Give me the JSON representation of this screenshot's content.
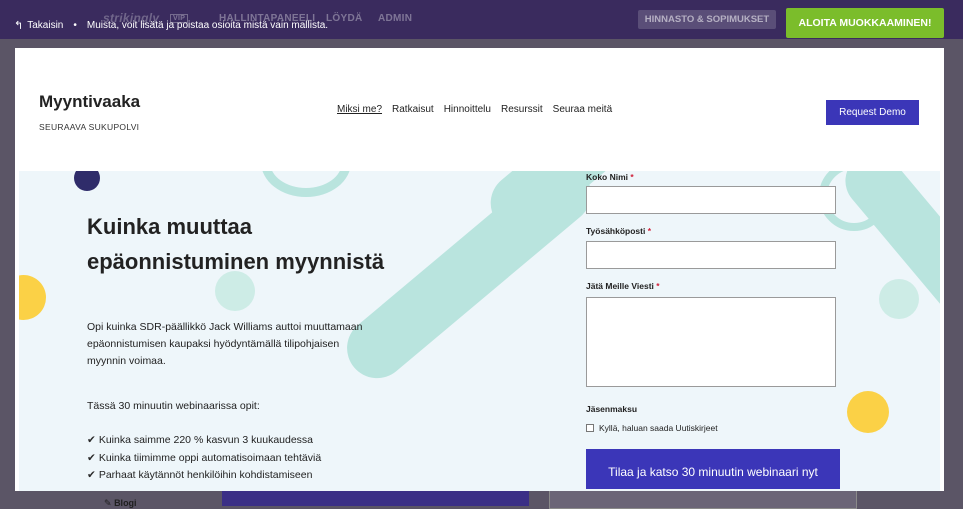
{
  "topbar": {
    "back_label": "Takaisin",
    "separator": "•",
    "hint": "Muista, voit lisätä ja poistaa osioita mistä vain mallista.",
    "logo": "strikingly",
    "logo_badge": "VIP",
    "nav": [
      "HALLINTAPANEELI",
      "LÖYDÄ",
      "ADMIN"
    ],
    "pricing_button": "HINNASTO & SOPIMUKSET",
    "start_button": "ALOITA MUOKKAAMINEN!"
  },
  "background_editor": {
    "blog_label": "Blogi"
  },
  "site": {
    "brand_title": "Myyntivaaka",
    "brand_subtitle": "SEURAAVA SUKUPOLVI",
    "nav": [
      "Miksi me?",
      "Ratkaisut",
      "Hinnoittelu",
      "Resurssit",
      "Seuraa meitä"
    ],
    "demo_button": "Request Demo"
  },
  "hero": {
    "title": "Kuinka muuttaa epäonnistuminen myynnistä",
    "description": "Opi kuinka SDR-päällikkö Jack Williams auttoi muuttamaan epäonnistumisen kaupaksi hyödyntämällä tilipohjaisen myynnin voimaa.",
    "intro": "Tässä 30 minuutin webinaarissa opit:",
    "check_symbol": "✔",
    "bullets": [
      "Kuinka saimme 220 % kasvun 3 kuukaudessa",
      "Kuinka tiimimme oppi automatisoimaan tehtäviä",
      "Parhaat käytännöt henkilöihin kohdistamiseen"
    ]
  },
  "form": {
    "name_label": "Koko Nimi",
    "email_label": "Työsähköposti",
    "message_label": "Jätä Meille Viesti",
    "required_mark": "*",
    "membership_label": "Jäsenmaksu",
    "newsletter_label": "Kyllä, haluan saada Uutiskirjeet",
    "submit_label": "Tilaa ja katso 30 minuutin webinaari nyt"
  },
  "colors": {
    "topbar": "#3a2b5e",
    "accent_green": "#7bbd2b",
    "primary_blue": "#3b36b8",
    "hero_bg": "#eef6fa",
    "mint": "#b9e4de",
    "yellow": "#fbd146",
    "navy": "#2f2c6a"
  }
}
